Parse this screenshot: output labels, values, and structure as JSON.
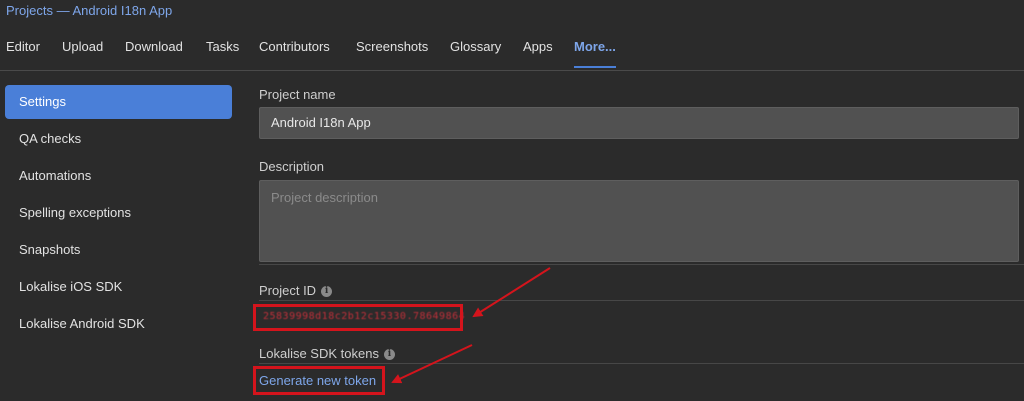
{
  "breadcrumb": "Projects — Android I18n App",
  "nav": {
    "tabs": [
      {
        "label": "Editor"
      },
      {
        "label": "Upload"
      },
      {
        "label": "Download"
      },
      {
        "label": "Tasks"
      },
      {
        "label": "Contributors"
      },
      {
        "label": "Screenshots"
      },
      {
        "label": "Glossary"
      },
      {
        "label": "Apps"
      },
      {
        "label": "More...",
        "active": true
      }
    ]
  },
  "sidebar": {
    "items": [
      {
        "label": "Settings",
        "active": true
      },
      {
        "label": "QA checks"
      },
      {
        "label": "Automations"
      },
      {
        "label": "Spelling exceptions"
      },
      {
        "label": "Snapshots"
      },
      {
        "label": "Lokalise iOS SDK"
      },
      {
        "label": "Lokalise Android SDK"
      }
    ]
  },
  "form": {
    "project_name_label": "Project name",
    "project_name_value": "Android I18n App",
    "description_label": "Description",
    "description_placeholder": "Project description",
    "project_id_label": "Project ID",
    "project_id_value": "25839998d18c2b12c15330.78649864",
    "sdk_tokens_label": "Lokalise SDK tokens",
    "generate_token_link": "Generate new token"
  },
  "colors": {
    "background": "#2b2b2b",
    "accent": "#4a7fd8",
    "link": "#7ea6ea",
    "annotation_red": "#d4141c"
  },
  "icons": {
    "info": "info-icon",
    "arrow": "red-arrow-annotation"
  }
}
